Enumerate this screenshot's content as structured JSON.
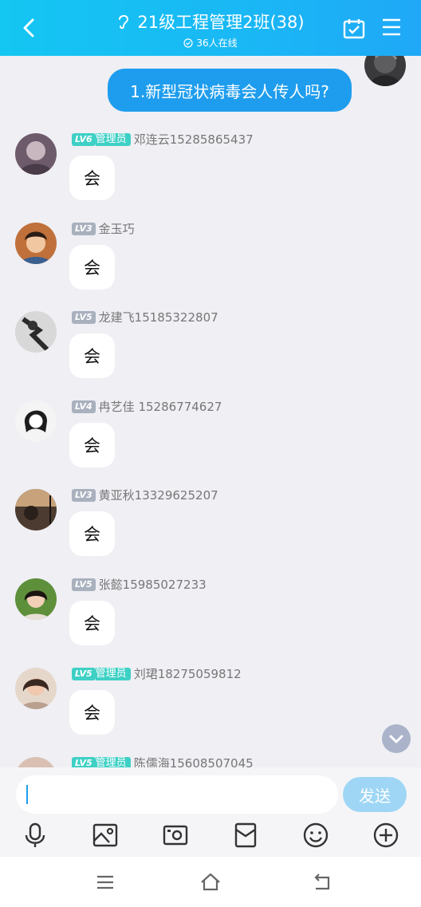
{
  "header": {
    "title": "21级工程管理2班(38)",
    "online": "36人在线",
    "brand_color": "#17b8f4"
  },
  "my_message": {
    "text": "1.新型冠状病毒会人传人吗?",
    "bubble_color": "#1e9dee"
  },
  "messages": [
    {
      "level": "LV6",
      "role": "管理员",
      "name": "邓连云15285865437",
      "text": "会"
    },
    {
      "level": "LV3",
      "role": "",
      "name": "金玉巧",
      "text": "会"
    },
    {
      "level": "LV5",
      "role": "",
      "name": "龙建飞15185322807",
      "text": "会"
    },
    {
      "level": "LV4",
      "role": "",
      "name": "冉艺佳  15286774627",
      "text": "会"
    },
    {
      "level": "LV3",
      "role": "",
      "name": "黄亚秋13329625207",
      "text": "会"
    },
    {
      "level": "LV5",
      "role": "",
      "name": "张懿15985027233",
      "text": "会"
    },
    {
      "level": "LV5",
      "role": "管理员",
      "name": "刘珺18275059812",
      "text": "会"
    },
    {
      "level": "LV5",
      "role": "管理员",
      "name": "陈儒海15608507045",
      "text": ""
    }
  ],
  "composer": {
    "send_label": "发送",
    "tools": [
      "microphone-icon",
      "image-icon",
      "camera-icon",
      "red-packet-icon",
      "emoji-icon",
      "plus-icon"
    ]
  },
  "system_nav": [
    "menu-icon",
    "home-icon",
    "back-icon"
  ]
}
